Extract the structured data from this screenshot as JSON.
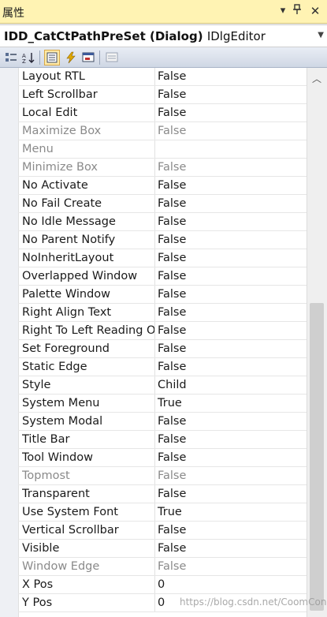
{
  "window": {
    "title": "属性"
  },
  "selector": {
    "name": "IDD_CatCtPathPreSet (Dialog)",
    "type": "IDlgEditor"
  },
  "toolbar": {
    "buttons": [
      {
        "icon": "categorized-icon"
      },
      {
        "icon": "alphabetical-icon"
      },
      {
        "icon": "properties-icon",
        "active": true
      },
      {
        "icon": "events-icon"
      },
      {
        "icon": "messages-icon"
      },
      {
        "icon": "overrides-icon"
      },
      {
        "icon": "property-pages-icon"
      }
    ]
  },
  "properties": [
    {
      "name": "Layout RTL",
      "value": "False"
    },
    {
      "name": "Left Scrollbar",
      "value": "False"
    },
    {
      "name": "Local Edit",
      "value": "False"
    },
    {
      "name": "Maximize Box",
      "value": "False",
      "readonly": true
    },
    {
      "name": "Menu",
      "value": "",
      "readonly": true
    },
    {
      "name": "Minimize Box",
      "value": "False",
      "readonly": true
    },
    {
      "name": "No Activate",
      "value": "False"
    },
    {
      "name": "No Fail Create",
      "value": "False"
    },
    {
      "name": "No Idle Message",
      "value": "False"
    },
    {
      "name": "No Parent Notify",
      "value": "False"
    },
    {
      "name": "NoInheritLayout",
      "value": "False"
    },
    {
      "name": "Overlapped Window",
      "value": "False"
    },
    {
      "name": "Palette Window",
      "value": "False"
    },
    {
      "name": "Right Align Text",
      "value": "False"
    },
    {
      "name": "Right To Left Reading Order",
      "value": "False"
    },
    {
      "name": "Set Foreground",
      "value": "False"
    },
    {
      "name": "Static Edge",
      "value": "False"
    },
    {
      "name": "Style",
      "value": "Child"
    },
    {
      "name": "System Menu",
      "value": "True"
    },
    {
      "name": "System Modal",
      "value": "False"
    },
    {
      "name": "Title Bar",
      "value": "False"
    },
    {
      "name": "Tool Window",
      "value": "False"
    },
    {
      "name": "Topmost",
      "value": "False",
      "readonly": true
    },
    {
      "name": "Transparent",
      "value": "False"
    },
    {
      "name": "Use System Font",
      "value": "True"
    },
    {
      "name": "Vertical Scrollbar",
      "value": "False"
    },
    {
      "name": "Visible",
      "value": "False"
    },
    {
      "name": "Window Edge",
      "value": "False",
      "readonly": true
    },
    {
      "name": "X Pos",
      "value": "0"
    },
    {
      "name": "Y Pos",
      "value": "0"
    }
  ],
  "watermark": {
    "text": "https://blog.csdn.net/CoomCon"
  }
}
